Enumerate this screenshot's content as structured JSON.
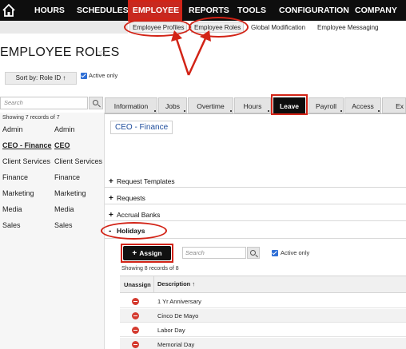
{
  "top_nav": {
    "items": [
      "HOURS",
      "SCHEDULES",
      "EMPLOYEE",
      "REPORTS",
      "TOOLS",
      "CONFIGURATION",
      "COMPANY"
    ],
    "active": "EMPLOYEE",
    "active_color": "#c8281f"
  },
  "sub_nav": {
    "items": [
      "Employee Profiles",
      "Employee Roles",
      "Global Modification",
      "Employee Messaging"
    ],
    "active": "Employee Roles"
  },
  "page": {
    "title": "EMPLOYEE ROLES",
    "sort_label": "Sort by: Role ID ↑",
    "active_only_label": "Active only",
    "active_only_checked": true
  },
  "left_panel": {
    "search_placeholder": "Search",
    "showing": "Showing 7 records of 7",
    "roles": [
      {
        "name": "Admin",
        "id": "Admin"
      },
      {
        "name": "CEO - Finance",
        "id": "CEO",
        "selected": true
      },
      {
        "name": "Client Services",
        "id": "Client Services"
      },
      {
        "name": "Finance",
        "id": "Finance"
      },
      {
        "name": "Marketing",
        "id": "Marketing"
      },
      {
        "name": "Media",
        "id": "Media"
      },
      {
        "name": "Sales",
        "id": "Sales"
      }
    ]
  },
  "tabs": {
    "items": [
      "Information",
      "Jobs",
      "Overtime",
      "Hours",
      "Leave",
      "Payroll",
      "Access",
      "Ex"
    ],
    "active": "Leave"
  },
  "main": {
    "role_title": "CEO - Finance",
    "sections": [
      "Request Templates",
      "Requests",
      "Accrual Banks",
      "Holidays"
    ],
    "expanded_section": "Holidays",
    "holidays": {
      "assign_label": "Assign",
      "search_placeholder": "Search",
      "active_only_label": "Active only",
      "active_only_checked": true,
      "showing": "Showing 8 records of 8",
      "col_unassign": "Unassign",
      "col_description": "Description ↑",
      "rows": [
        "1 Yr Anniversary",
        "Cinco De Mayo",
        "Labor Day",
        "Memorial Day"
      ]
    }
  },
  "annotation_color": "#d22316"
}
